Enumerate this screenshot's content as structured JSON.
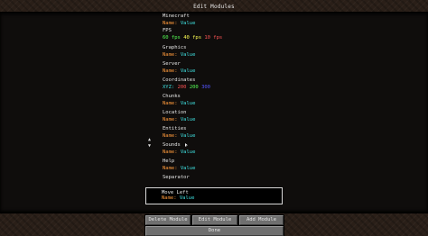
{
  "title": "Edit Modules",
  "modules": [
    {
      "name": "Minecraft",
      "values": [
        {
          "text": "Name: Value",
          "color": "#3fe0e0",
          "split": true
        }
      ]
    },
    {
      "name": "FPS",
      "values": [
        {
          "text": "60 fps",
          "color": "#55ff55"
        },
        {
          "text": "40 fps",
          "color": "#ffff55"
        },
        {
          "text": "10 fps",
          "color": "#ff5555"
        }
      ]
    },
    {
      "name": "Graphics",
      "values": [
        {
          "text": "Name: Value",
          "color": "#3fe0e0",
          "split": true
        }
      ]
    },
    {
      "name": "Server",
      "values": [
        {
          "text": "Name: Value",
          "color": "#3fe0e0",
          "split": true
        }
      ]
    },
    {
      "name": "Coordinates",
      "values": [
        {
          "text": "XYZ:",
          "color": "#3fe0e0"
        },
        {
          "text": "200",
          "color": "#ff5555"
        },
        {
          "text": "200",
          "color": "#55ff55"
        },
        {
          "text": "300",
          "color": "#5555ff"
        }
      ]
    },
    {
      "name": "Chunks",
      "values": [
        {
          "text": "Name: Value",
          "color": "#3fe0e0",
          "split": true
        }
      ]
    },
    {
      "name": "Location",
      "values": [
        {
          "text": "Name: Value",
          "color": "#3fe0e0",
          "split": true
        }
      ]
    },
    {
      "name": "Entities",
      "values": [
        {
          "text": "Name: Value",
          "color": "#3fe0e0",
          "split": true
        }
      ]
    },
    {
      "name": "Sounds",
      "values": [
        {
          "text": "Name: Value",
          "color": "#3fe0e0",
          "split": true
        }
      ]
    },
    {
      "name": "Help",
      "values": [
        {
          "text": "Name: Value",
          "color": "#3fe0e0",
          "split": true
        }
      ]
    },
    {
      "name": "Separator",
      "values": []
    }
  ],
  "selected": {
    "name": "Move Left",
    "value": "Name: Value",
    "name_color": "#ff9a3c",
    "value_color": "#3fe0e0"
  },
  "scroll_up": "▲",
  "scroll_down": "▼",
  "buttons": {
    "delete": "Delete Module",
    "edit": "Edit Module",
    "add": "Add Module",
    "done": "Done"
  },
  "colors": {
    "label": "#ff9a3c",
    "value": "#3fe0e0"
  }
}
